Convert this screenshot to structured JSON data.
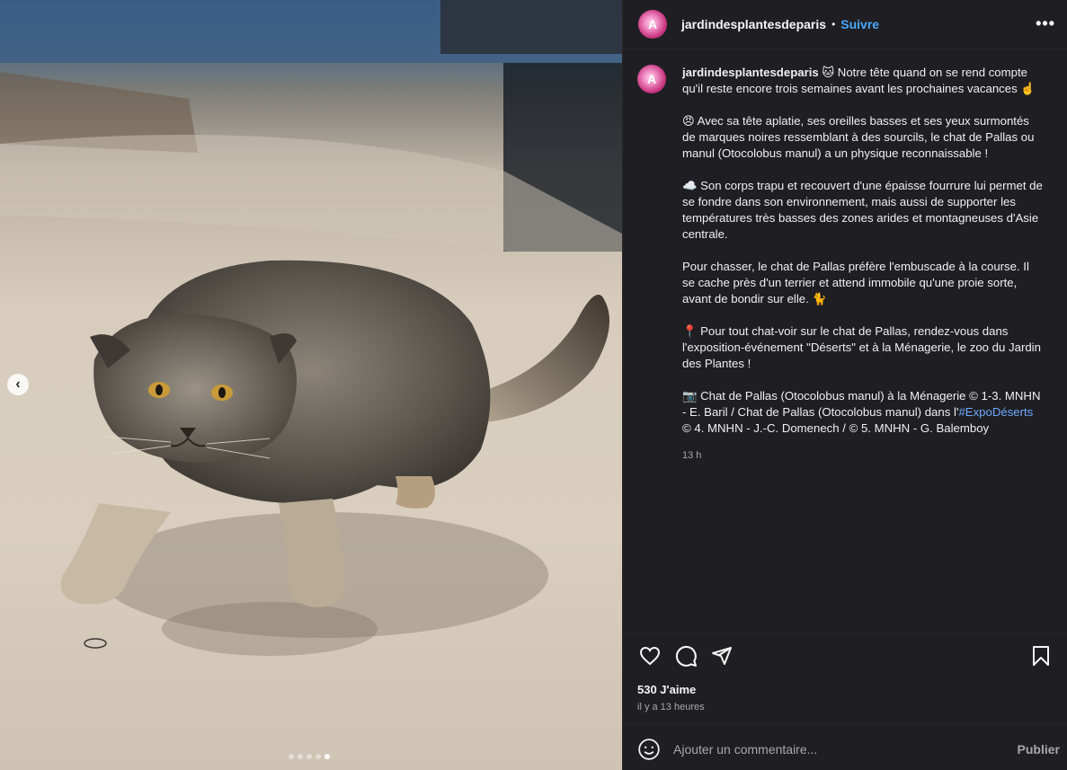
{
  "post": {
    "username": "jardindesplantesdeparis",
    "avatar_letter": "A",
    "separator": "•",
    "follow_label": "Suivre",
    "more_label": "•••",
    "caption": {
      "username": "jardindesplantesdeparis",
      "intro": "🐱 Notre tête quand on se rend compte qu'il reste encore trois semaines avant les prochaines vacances ☝️",
      "p2": "😠 Avec sa tête aplatie, ses oreilles basses et ses yeux surmontés de marques noires ressemblant à des sourcils, le chat de Pallas ou manul (Otocolobus manul) a un physique reconnaissable !",
      "p3": "☁️ Son corps trapu et recouvert d'une épaisse fourrure lui permet de se fondre dans son environnement, mais aussi de supporter les températures très basses des zones arides et montagneuses d'Asie centrale.",
      "p4": "Pour chasser, le chat de Pallas préfère l'embuscade à la course. Il se cache près d'un terrier et attend immobile qu'une proie sorte, avant de bondir sur elle. 🐈",
      "p5": "📍 Pour tout chat-voir sur le chat de Pallas, rendez-vous dans l'exposition-événement \"Déserts\" et à la Ménagerie, le zoo du Jardin des Plantes !",
      "credits_before": "📷 Chat de Pallas (Otocolobus manul) à la Ménagerie © 1-3. MNHN - E. Baril / Chat de Pallas (Otocolobus manul) dans l'",
      "hashtag": "#ExpoDéserts",
      "credits_after": " © 4. MNHN - J.-C. Domenech / © 5. MNHN - G. Balemboy",
      "time": "13 h"
    },
    "likes": "530 J'aime",
    "posted_ago": "il y a 13 heures",
    "comment_placeholder": "Ajouter un commentaire...",
    "publish_label": "Publier",
    "carousel": {
      "count": 5,
      "active_index": 4
    },
    "icons": [
      "heart-icon",
      "comment-icon",
      "share-icon",
      "bookmark-icon",
      "emoji-icon",
      "chevron-left-icon"
    ],
    "colors": {
      "follow": "#4aa8ff",
      "hashtag": "#6ea8ff",
      "panel_bg": "#1f1f23"
    }
  }
}
